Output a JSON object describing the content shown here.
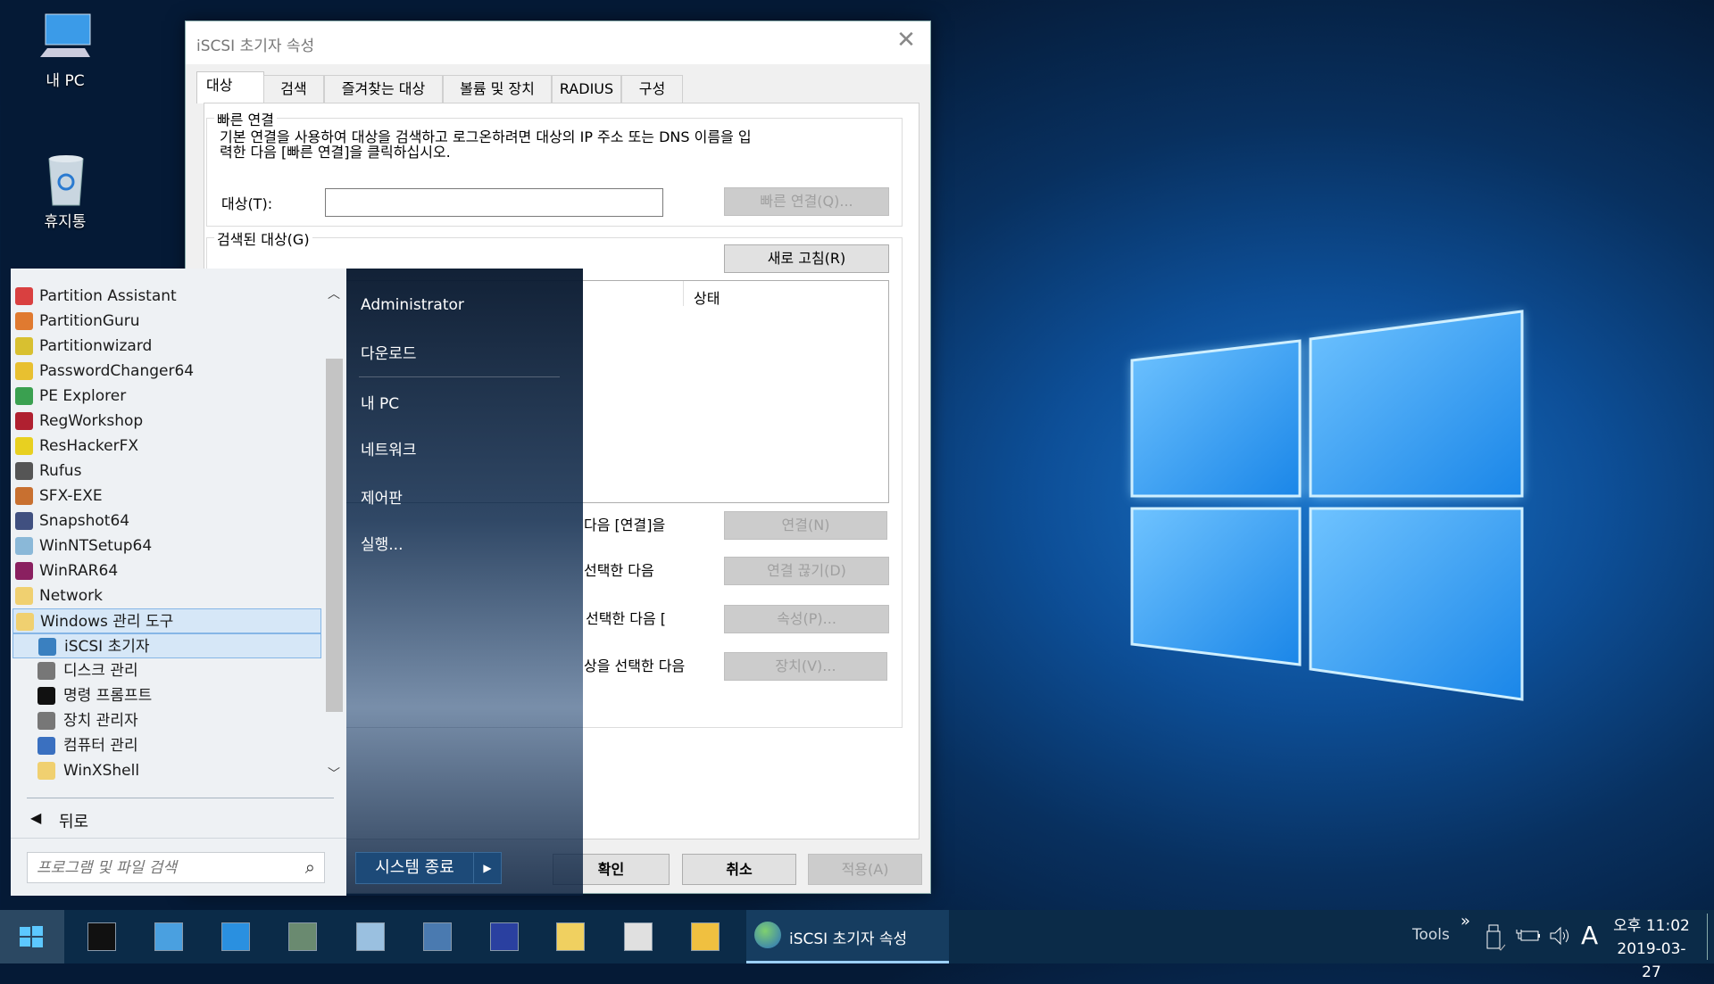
{
  "desktop": {
    "icons": [
      {
        "label": "내 PC",
        "icon": "computer-icon"
      },
      {
        "label": "휴지통",
        "icon": "recycle-bin-icon"
      }
    ]
  },
  "dialog": {
    "title": "iSCSI 초기자 속성",
    "tabs": [
      {
        "label": "대상",
        "active": true
      },
      {
        "label": "검색"
      },
      {
        "label": "즐겨찾는 대상"
      },
      {
        "label": "볼륨 및 장치"
      },
      {
        "label": "RADIUS"
      },
      {
        "label": "구성"
      }
    ],
    "quick_connect": {
      "legend": "빠른 연결",
      "description_line1": "기본 연결을 사용하여 대상을 검색하고 로그온하려면 대상의 IP 주소 또는 DNS 이름을 입",
      "description_line2": "력한 다음 [빠른 연결]을 클릭하십시오.",
      "target_label": "대상(T):",
      "target_value": "",
      "button": "빠른 연결(Q)..."
    },
    "discovered": {
      "legend": "검색된 대상(G)",
      "refresh_button": "새로 고침(R)",
      "column_status": "상태",
      "rows": [
        {
          "text": "다음 [연결]을",
          "button": "연결(N)"
        },
        {
          "text": "선택한 다음",
          "button": "연결 끊기(D)"
        },
        {
          "text": "선택한 다음 [",
          "button": "속성(P)..."
        },
        {
          "text": "상을 선택한 다음",
          "button": "장치(V)..."
        }
      ]
    },
    "footer": {
      "ok": "확인",
      "cancel": "취소",
      "apply": "적용(A)"
    }
  },
  "start_menu": {
    "programs": [
      {
        "label": "Partition Assistant",
        "color": "#d94040"
      },
      {
        "label": "PartitionGuru",
        "color": "#e07a30"
      },
      {
        "label": "Partitionwizard",
        "color": "#d8c030"
      },
      {
        "label": "PasswordChanger64",
        "color": "#e8c030"
      },
      {
        "label": "PE Explorer",
        "color": "#3aa050"
      },
      {
        "label": "RegWorkshop",
        "color": "#b02030"
      },
      {
        "label": "ResHackerFX",
        "color": "#e8d020"
      },
      {
        "label": "Rufus",
        "color": "#555555"
      },
      {
        "label": "SFX-EXE",
        "color": "#c87030"
      },
      {
        "label": "Snapshot64",
        "color": "#405080"
      },
      {
        "label": "WinNTSetup64",
        "color": "#8ab8d8"
      },
      {
        "label": "WinRAR64",
        "color": "#8a2060"
      },
      {
        "label": "Network",
        "color": "#f0d070"
      },
      {
        "label": "Windows 관리 도구",
        "color": "#f0d070",
        "highlight": true
      },
      {
        "label": "iSCSI 초기자",
        "color": "#3a80c0",
        "child": true,
        "highlight": true
      },
      {
        "label": "디스크 관리",
        "color": "#777777",
        "child": true
      },
      {
        "label": "명령 프롬프트",
        "color": "#111111",
        "child": true
      },
      {
        "label": "장치 관리자",
        "color": "#777777",
        "child": true
      },
      {
        "label": "컴퓨터 관리",
        "color": "#3a70c0",
        "child": true
      },
      {
        "label": "WinXShell",
        "color": "#f0d070",
        "child": true
      }
    ],
    "back": "뒤로",
    "search_placeholder": "프로그램 및 파일 검색",
    "places": [
      "Administrator",
      "다운로드",
      "내 PC",
      "네트워크",
      "제어판",
      "실행..."
    ],
    "shutdown": "시스템 종료"
  },
  "taskbar": {
    "pinned": [
      "command-prompt-icon",
      "network-monitor-icon",
      "internet-explorer-icon",
      "hardware-info-icon",
      "notepad-icon",
      "search-tool-icon",
      "floppy-save-icon",
      "file-upload-icon",
      "registry-upload-icon",
      "file-explorer-icon"
    ],
    "active_task": "iSCSI 초기자 속성",
    "toolbar": "Tools",
    "overflow": "»",
    "ime": "A",
    "time": "오후 11:02",
    "date": "2019-03-27"
  }
}
